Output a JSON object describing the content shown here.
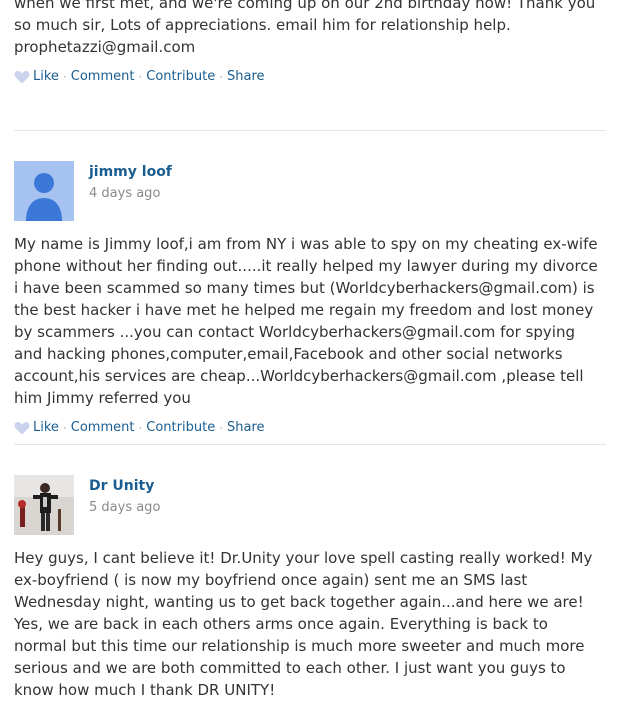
{
  "comments": [
    {
      "text": "when we first met, and we're coming up on our 2nd birthday now! Thank you so much sir, Lots of appreciations. email him for relationship help. prophetazzi@gmail.com",
      "actions": {
        "like": "Like",
        "comment": "Comment",
        "contribute": "Contribute",
        "share": "Share"
      }
    },
    {
      "author": "jimmy loof",
      "time": "4 days ago",
      "avatar": "default-user-icon",
      "text": "My name is Jimmy loof,i am from NY i was able to spy on my cheating ex-wife phone without her finding out.....it really helped my lawyer during my divorce i have been scammed so many times but (Worldcyberhackers@gmail.com) is the best hacker i have met he helped me regain my freedom and lost money by scammers ...you can contact Worldcyberhackers@gmail.com for spying and hacking phones,computer,email,Facebook and other social networks account,his services are cheap...Worldcyberhackers@gmail.com ,please tell him Jimmy referred you",
      "actions": {
        "like": "Like",
        "comment": "Comment",
        "contribute": "Contribute",
        "share": "Share"
      }
    },
    {
      "author": "Dr Unity",
      "time": "5 days ago",
      "avatar": "user-photo",
      "text": "Hey guys, I cant believe it! Dr.Unity your love spell casting really worked! My ex-boyfriend ( is now my boyfriend once again) sent me an SMS last Wednesday night, wanting us to get back together again...and here we are! Yes, we are back in each others arms once again. Everything is back to normal but this time our relationship is much more sweeter and much more serious and we are both committed to each other. I just want you guys to know how much I thank DR UNITY!"
    }
  ],
  "separator": "·",
  "colors": {
    "link": "#1a5e91",
    "text": "#333333",
    "muted": "#8a8a8a",
    "divider": "#e6e6e6",
    "avatar_bg": "#a6c2f0",
    "avatar_fg": "#3b78d8"
  }
}
